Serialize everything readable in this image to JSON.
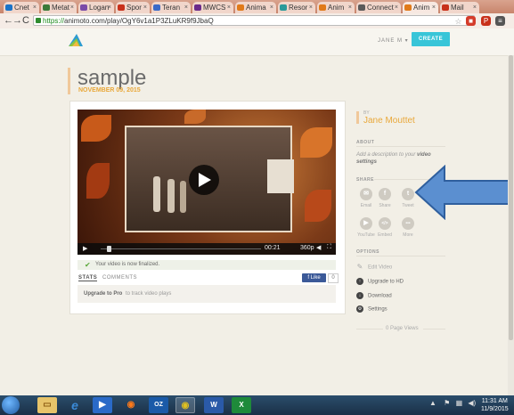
{
  "browser": {
    "tabs": [
      {
        "label": "Cnet",
        "color": "#1a73c8"
      },
      {
        "label": "Metat",
        "color": "#3a7a3a"
      },
      {
        "label": "Logan",
        "color": "#7a4ba8"
      },
      {
        "label": "Spor",
        "color": "#c8301a"
      },
      {
        "label": "Teran",
        "color": "#3a6ac8"
      },
      {
        "label": "MWCS",
        "color": "#6b2a8a"
      },
      {
        "label": "Anima",
        "color": "#e07a1a"
      },
      {
        "label": "Resor",
        "color": "#2a9a9a"
      },
      {
        "label": "Anim",
        "color": "#e07a1a"
      },
      {
        "label": "Connect",
        "color": "#5a5a5a"
      },
      {
        "label": "Anim",
        "color": "#e07a1a",
        "active": true
      },
      {
        "label": "Mail",
        "color": "#c8301a"
      }
    ],
    "url_scheme": "https://",
    "url_rest": "animoto.com/play/OgY6v1a1P3ZLuKR9f9JbaQ"
  },
  "header": {
    "user_menu": "JANE M ▾",
    "create_label": "CREATE"
  },
  "video": {
    "title": "sample",
    "date": "NOVEMBER 09, 2015",
    "time": "00:21",
    "quality": "360p",
    "status_text": "Your video is now finalized.",
    "tab_stats": "STATS",
    "tab_comments": "COMMENTS",
    "like_label": "Like",
    "like_count": "0",
    "upgrade_link": "Upgrade to Pro",
    "upgrade_rest": "to track video plays"
  },
  "sidebar": {
    "by_label": "BY",
    "author": "Jane Mouttet",
    "about_heading": "ABOUT",
    "about_text_pre": "Add a description to your",
    "about_text_bold": "video settings",
    "share_heading": "SHARE",
    "share_items": [
      {
        "label": "Email",
        "glyph": "✉"
      },
      {
        "label": "Share",
        "glyph": "f"
      },
      {
        "label": "Tweet",
        "glyph": "t"
      },
      {
        "label": "YouTube",
        "glyph": "▶"
      },
      {
        "label": "Embed",
        "glyph": "</>"
      },
      {
        "label": "More",
        "glyph": "•••"
      }
    ],
    "options_heading": "OPTIONS",
    "options": [
      {
        "label": "Edit Video",
        "icon": "pencil-icon",
        "glyph": "✎"
      },
      {
        "label": "Upgrade to HD",
        "icon": "hd-icon",
        "glyph": "↑"
      },
      {
        "label": "Download",
        "icon": "download-icon",
        "glyph": "↓"
      },
      {
        "label": "Settings",
        "icon": "gear-icon",
        "glyph": "⚙"
      }
    ],
    "page_views": "0 Page Views"
  },
  "taskbar": {
    "clock_time": "11:31 AM",
    "clock_date": "11/9/2015"
  }
}
